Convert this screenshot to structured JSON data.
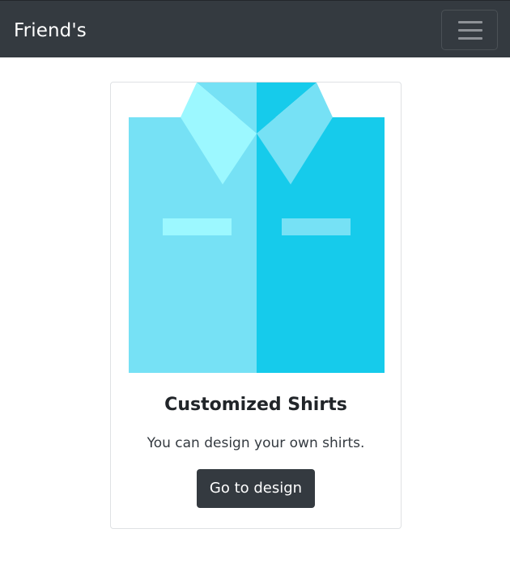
{
  "navbar": {
    "brand": "Friend's",
    "toggler_icon": "hamburger-menu-icon"
  },
  "card": {
    "image_icon": "shirt-illustration",
    "title": "Customized Shirts",
    "text": "You can design your own shirts.",
    "button_label": "Go to design"
  },
  "colors": {
    "navbar_bg": "#343a40",
    "button_bg": "#343a40",
    "shirt_left": "#76e1f5",
    "shirt_right": "#16cbeb",
    "collar_light": "#9cf8ff",
    "collar_mid": "#76e1f5"
  }
}
